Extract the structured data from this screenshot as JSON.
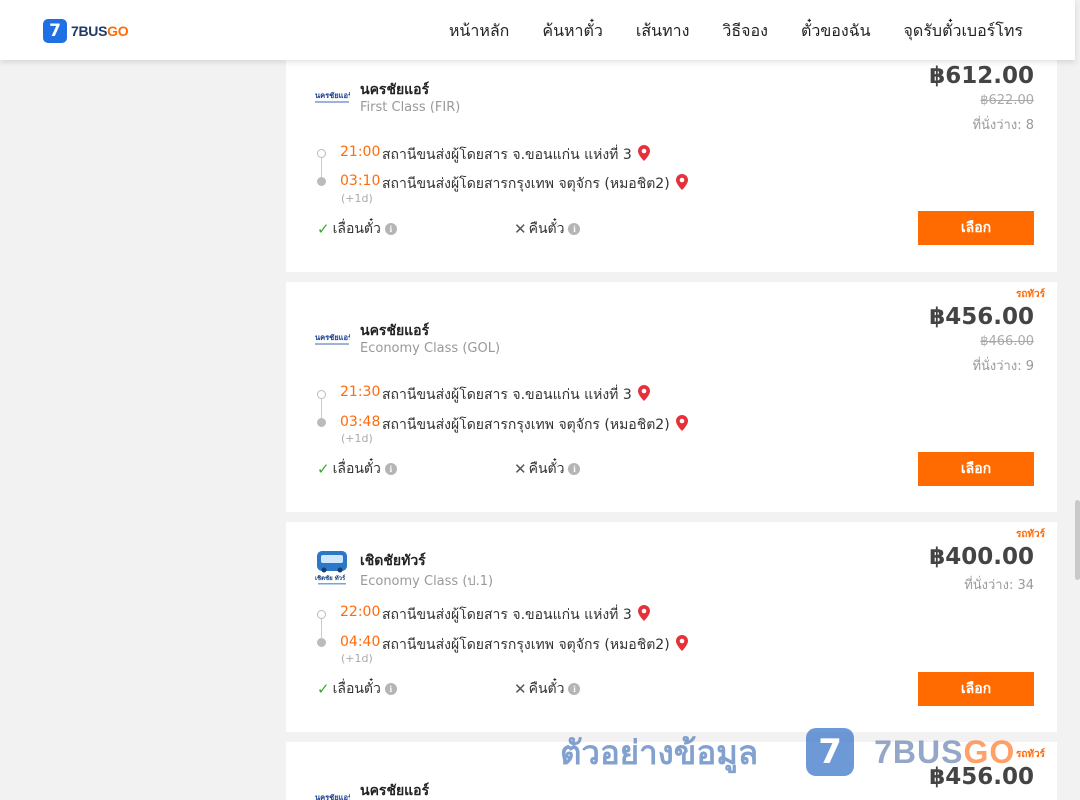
{
  "header": {
    "logo_mark": "7",
    "logo_text_main": "7BUS",
    "logo_text_accent": "GO",
    "nav": [
      "หน้าหลัก",
      "ค้นหาตั๋ว",
      "เส้นทาง",
      "วิธีจอง",
      "ตั๋วของฉัน",
      "จุดรับตั๋วเบอร์โทร"
    ]
  },
  "colors": {
    "accent": "#ff6b00",
    "time": "#ff6b0a",
    "brand_blue": "#1f6fe5",
    "check": "#3aaa35"
  },
  "trips": [
    {
      "badge": "",
      "operator": "นครชัยแอร์",
      "class": "First Class (FIR)",
      "price": "฿612.00",
      "old_price": "฿622.00",
      "seats": "ที่นั่งว่าง: 8",
      "dep_time": "21:00",
      "dep_station": "สถานีขนส่งผู้โดยสาร จ.ขอนแก่น แห่งที่ 3",
      "arr_time": "03:10",
      "arr_station": "สถานีขนส่งผู้โดยสารกรุงเทพ จตุจักร (หมอชิต2)",
      "plus_day": "(+1d)",
      "reschedule": "เลื่อนตั๋ว",
      "refund": "คืนตั๋ว",
      "select": "เลือก"
    },
    {
      "badge": "รถทัวร์",
      "operator": "นครชัยแอร์",
      "class": "Economy Class (GOL)",
      "price": "฿456.00",
      "old_price": "฿466.00",
      "seats": "ที่นั่งว่าง: 9",
      "dep_time": "21:30",
      "dep_station": "สถานีขนส่งผู้โดยสาร จ.ขอนแก่น แห่งที่ 3",
      "arr_time": "03:48",
      "arr_station": "สถานีขนส่งผู้โดยสารกรุงเทพ จตุจักร (หมอชิต2)",
      "plus_day": "(+1d)",
      "reschedule": "เลื่อนตั๋ว",
      "refund": "คืนตั๋ว",
      "select": "เลือก"
    },
    {
      "badge": "รถทัวร์",
      "operator": "เชิดชัยทัวร์",
      "class": "Economy Class (ป.1)",
      "price": "฿400.00",
      "old_price": "",
      "seats": "ที่นั่งว่าง: 34",
      "dep_time": "22:00",
      "dep_station": "สถานีขนส่งผู้โดยสาร จ.ขอนแก่น แห่งที่ 3",
      "arr_time": "04:40",
      "arr_station": "สถานีขนส่งผู้โดยสารกรุงเทพ จตุจักร (หมอชิต2)",
      "plus_day": "(+1d)",
      "reschedule": "เลื่อนตั๋ว",
      "refund": "คืนตั๋ว",
      "select": "เลือก"
    },
    {
      "badge": "รถทัวร์",
      "operator": "นครชัยแอร์",
      "price": "฿456.00"
    }
  ],
  "watermark": {
    "thai": "ตัวอย่างข้อมูล",
    "mark": "7",
    "text_main": "7BUS",
    "text_accent": "GO"
  }
}
